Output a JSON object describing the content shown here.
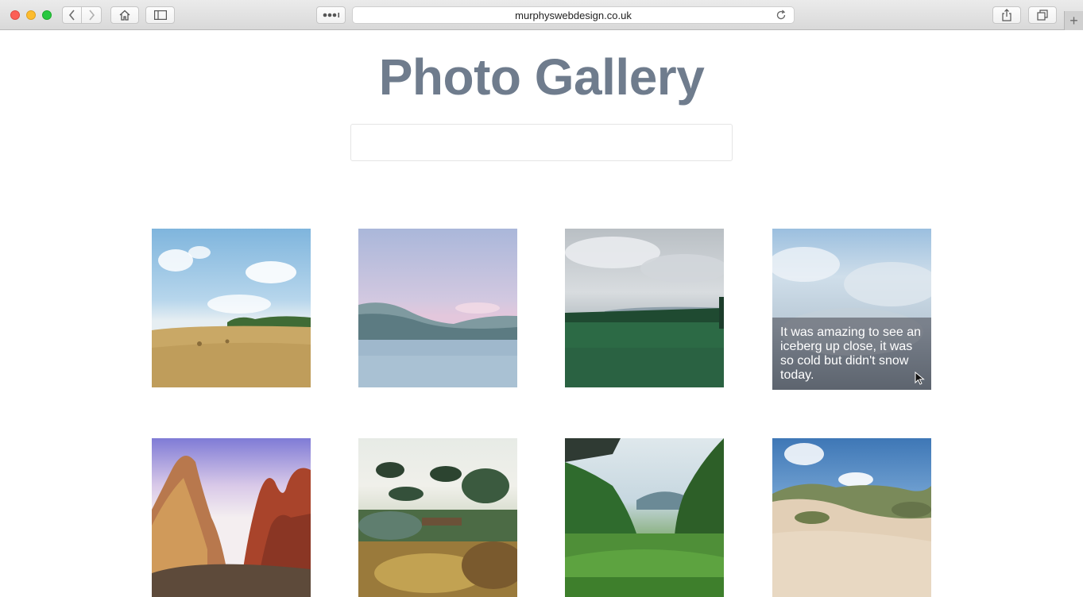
{
  "browser": {
    "url": "murphyswebdesign.co.uk",
    "buttons": {
      "back_icon": "chevron-left-icon",
      "forward_icon": "chevron-right-icon",
      "home_icon": "home-icon",
      "sidebar_icon": "sidebar-icon",
      "reader_icon": "dots-icon",
      "reload_icon": "reload-icon",
      "share_icon": "share-icon",
      "tabs_icon": "tabs-icon",
      "new_tab_label": "+"
    }
  },
  "page": {
    "title": "Photo Gallery",
    "search": {
      "value": "",
      "placeholder": ""
    },
    "accent_color": "#6f7c8d"
  },
  "gallery": {
    "photos": [
      {
        "subject": "wheat field"
      },
      {
        "subject": "mountain lake"
      },
      {
        "subject": "green meadow"
      },
      {
        "subject": "iceberg",
        "caption": "It was amazing to see an iceberg up close, it was so cold but didn't snow today."
      },
      {
        "subject": "red rock canyon"
      },
      {
        "subject": "garden trees"
      },
      {
        "subject": "forest valley"
      },
      {
        "subject": "sand dunes"
      }
    ]
  }
}
